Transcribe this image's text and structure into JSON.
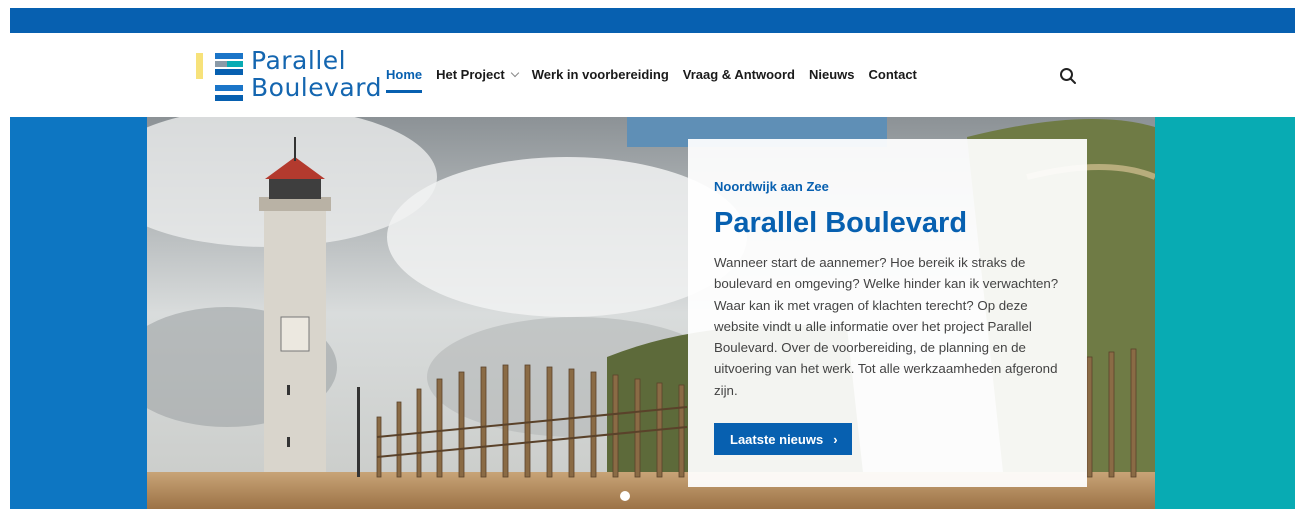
{
  "site": {
    "logo_line1": "Parallel",
    "logo_line2": "Boulevard"
  },
  "nav": {
    "items": [
      {
        "label": "Home",
        "active": true
      },
      {
        "label": "Het Project",
        "has_dropdown": true
      },
      {
        "label": "Werk in voorbereiding"
      },
      {
        "label": "Vraag & Antwoord"
      },
      {
        "label": "Nieuws"
      },
      {
        "label": "Contact"
      }
    ],
    "search_icon": "search-icon"
  },
  "hero": {
    "kicker": "Noordwijk aan Zee",
    "title": "Parallel Boulevard",
    "body": "Wanneer start de aannemer? Hoe bereik ik straks de boulevard en omgeving? Welke hinder kan ik verwachten? Waar kan ik met vragen of klachten terecht? Op deze website vindt u alle informatie over het project Parallel Boulevard. Over de voorbereiding, de planning en de uitvoering van het werk. Tot alle werkzaamheden afgerond zijn.",
    "button_label": "Laatste nieuws",
    "slide_count_visible": 1
  },
  "colors": {
    "brand_blue": "#0760b0",
    "hero_left": "#0d76c2",
    "hero_right": "#08abb3",
    "logo_yellow": "#f7e27a",
    "logo_gray": "#8a9aa8",
    "logo_teal": "#08abb3"
  }
}
